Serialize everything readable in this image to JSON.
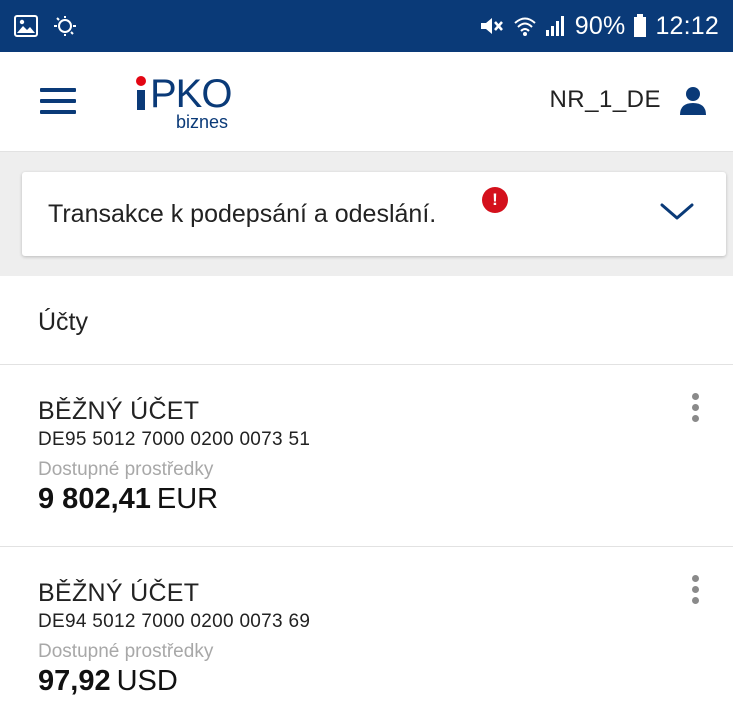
{
  "status_bar": {
    "battery": "90%",
    "time": "12:12",
    "left_icons": [
      "gallery-icon",
      "sync-icon"
    ],
    "right_icons": [
      "mute-icon",
      "wifi-icon",
      "signal-icon",
      "battery-icon"
    ]
  },
  "header": {
    "logo_main": "PKO",
    "logo_sub": "biznes",
    "user_name": "NR_1_DE",
    "icons": [
      "menu-icon",
      "user-icon"
    ]
  },
  "notice": {
    "text": "Transakce k podepsání a odeslání.",
    "badge": "!",
    "icon": "chevron-down-icon"
  },
  "accounts_section": {
    "title": "Účty",
    "items": [
      {
        "name": "BĚŽNÝ ÚČET",
        "iban": "DE95 5012 7000 0200 0073 51",
        "label": "Dostupné prostředky",
        "amount": "9 802,41",
        "currency": "EUR"
      },
      {
        "name": "BĚŽNÝ ÚČET",
        "iban": "DE94 5012 7000 0200 0073 69",
        "label": "Dostupné prostředky",
        "amount": "97,92",
        "currency": "USD"
      }
    ]
  },
  "colors": {
    "brand_blue": "#0a3a78",
    "brand_red": "#e30613",
    "alert_red": "#d4101c",
    "muted_text": "#a8a8a8"
  }
}
